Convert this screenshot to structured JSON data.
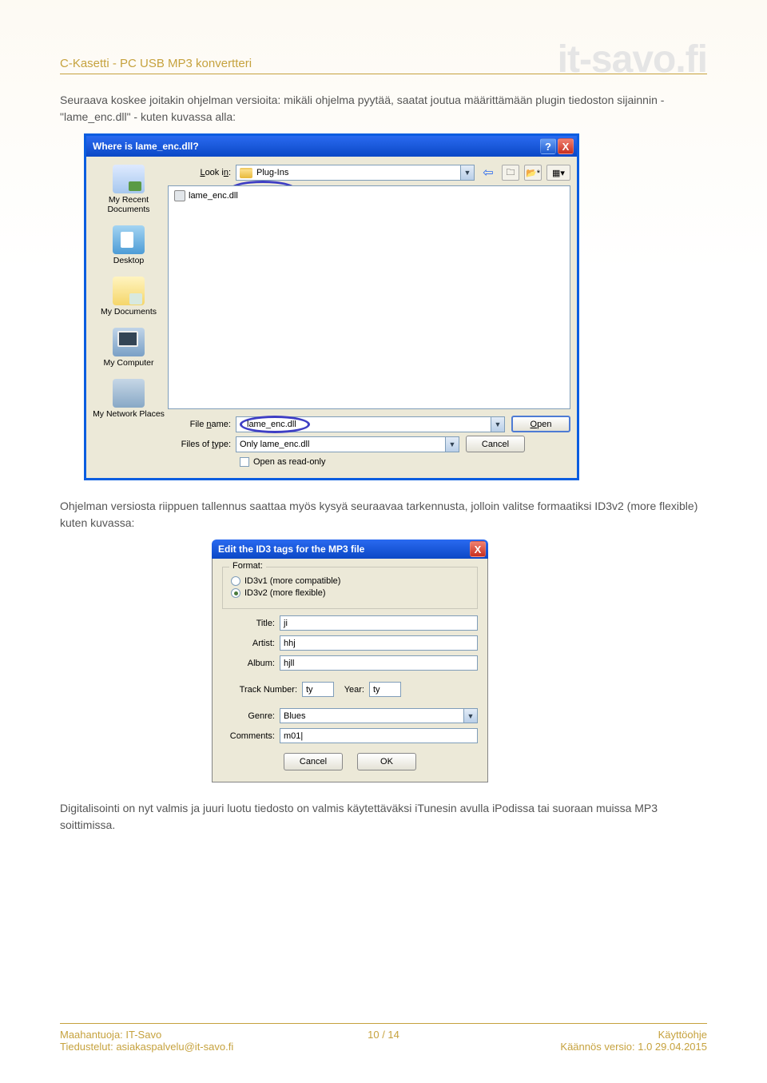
{
  "header": {
    "title": "C-Kasetti - PC USB MP3 konvertteri",
    "brand": "it-savo.fi"
  },
  "para1": "Seuraava koskee joitakin ohjelman versioita: mikäli ohjelma pyytää, saatat joutua määrittämään plugin tiedoston sijainnin - \"lame_enc.dll\" - kuten kuvassa alla:",
  "dialog1": {
    "title": "Where is lame_enc.dll?",
    "help": "?",
    "close": "X",
    "lookin_label": "Look in:",
    "lookin_value": "Plug-Ins",
    "file_in_list": "lame_enc.dll",
    "places": {
      "recent": "My Recent Documents",
      "desktop": "Desktop",
      "mydocs": "My Documents",
      "mycomp": "My Computer",
      "mynet": "My Network Places"
    },
    "filename_label": "File name:",
    "filename_value": "lame_enc.dll",
    "filetype_label": "Files of type:",
    "filetype_value": "Only lame_enc.dll",
    "open": "Open",
    "cancel": "Cancel",
    "readonly": "Open as read-only",
    "nav": {
      "back": "⇦",
      "up": "🗀",
      "new": "📂*",
      "views": "▦▾"
    }
  },
  "para2": "Ohjelman versiosta riippuen tallennus saattaa myös kysyä seuraavaa tarkennusta, jolloin valitse formaatiksi ID3v2 (more flexible) kuten kuvassa:",
  "dialog2": {
    "title": "Edit the ID3 tags for the MP3 file",
    "close": "X",
    "format_legend": "Format:",
    "opt1": "ID3v1 (more compatible)",
    "opt2": "ID3v2 (more flexible)",
    "title_label": "Title:",
    "title_value": "ji",
    "artist_label": "Artist:",
    "artist_value": "hhj",
    "album_label": "Album:",
    "album_value": "hjll",
    "track_label": "Track Number:",
    "track_value": "ty",
    "year_label": "Year:",
    "year_value": "ty",
    "genre_label": "Genre:",
    "genre_value": "Blues",
    "comments_label": "Comments:",
    "comments_value": "m01|",
    "cancel": "Cancel",
    "ok": "OK"
  },
  "para3": "Digitalisointi on nyt valmis ja juuri luotu tiedosto on valmis käytettäväksi iTunesin avulla iPodissa tai suoraan muissa MP3 soittimissa.",
  "footer": {
    "l1": "Maahantuoja: IT-Savo",
    "l2": "Tiedustelut: asiakaspalvelu@it-savo.fi",
    "page": "10 / 14",
    "r1": "Käyttöohje",
    "r2": "Käännös versio: 1.0 29.04.2015"
  }
}
